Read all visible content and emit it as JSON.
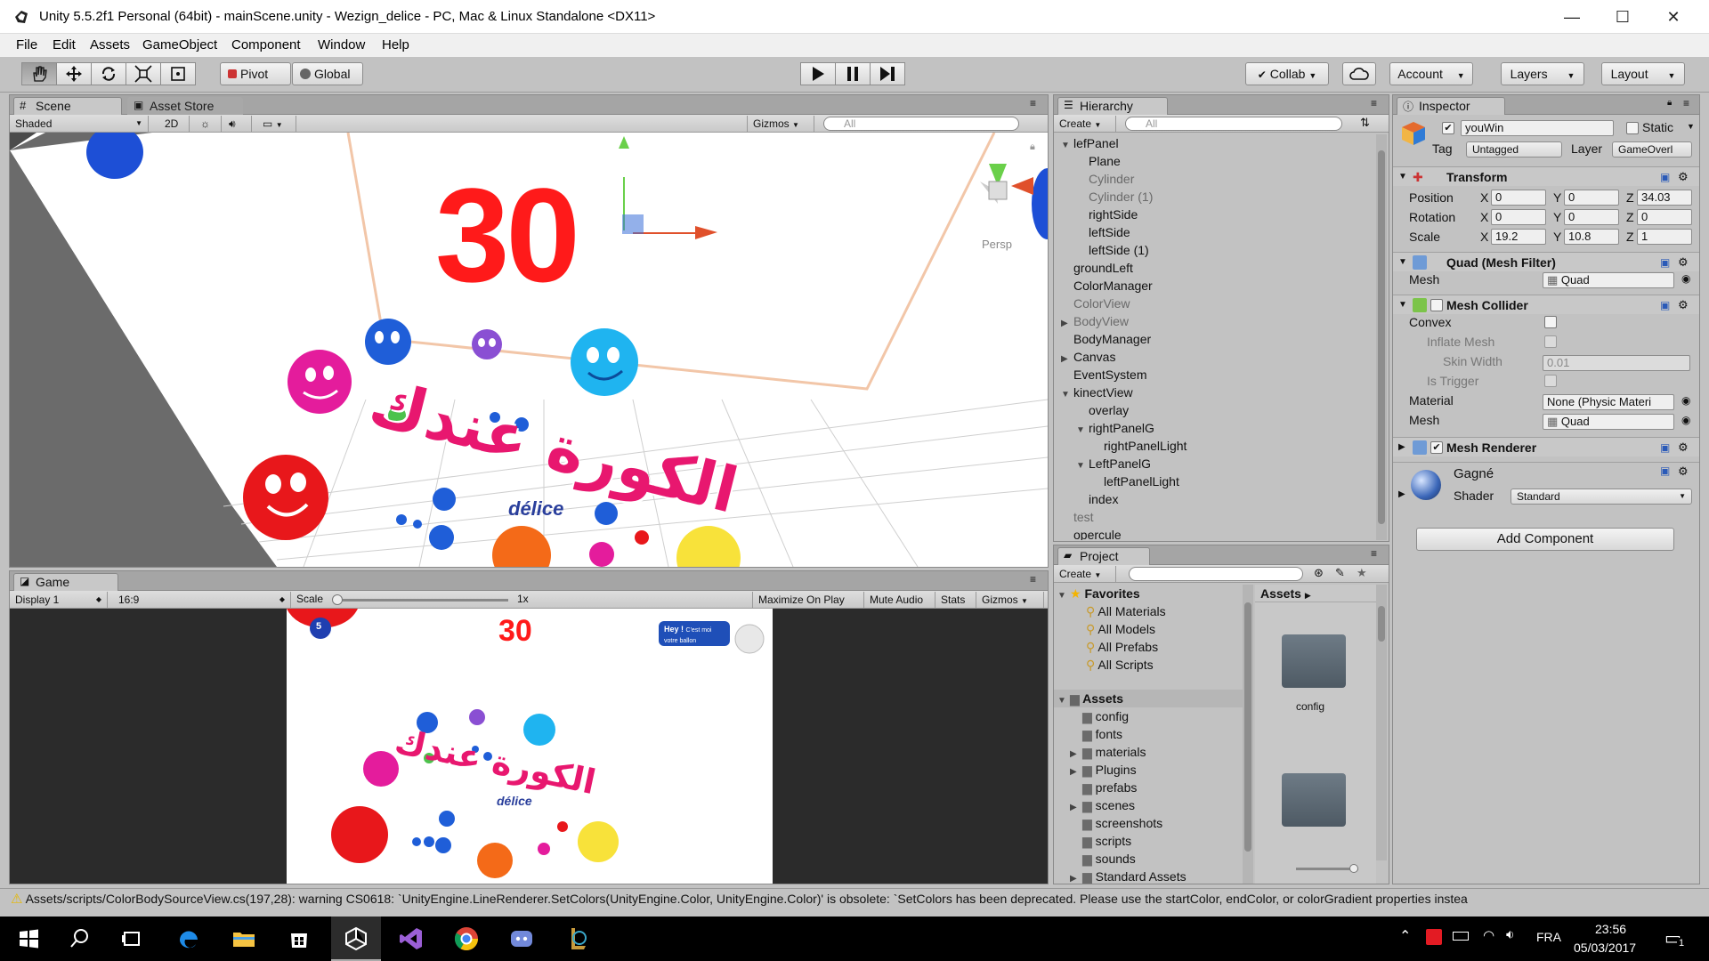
{
  "window": {
    "title": "Unity 5.5.2f1 Personal (64bit) - mainScene.unity - Wezign_delice - PC, Mac & Linux Standalone <DX11>",
    "minimize": "—",
    "maximize": "☐",
    "close": "✕"
  },
  "menu": [
    "File",
    "Edit",
    "Assets",
    "GameObject",
    "Component",
    "Window",
    "Help"
  ],
  "toolbar": {
    "pivot": "Pivot",
    "global": "Global",
    "collab": "Collab",
    "account": "Account",
    "layers": "Layers",
    "layout": "Layout"
  },
  "scene": {
    "tab": "Scene",
    "asset_store_tab": "Asset Store",
    "shading": "Shaded",
    "mode_2d": "2D",
    "gizmos": "Gizmos",
    "search_placeholder": "All",
    "persp": "Persp",
    "counter": "30",
    "arabic_text": "الكورة عندك",
    "brand": "délice"
  },
  "game": {
    "tab": "Game",
    "display": "Display 1",
    "aspect": "16:9",
    "scale_label": "Scale",
    "scale_value": "1x",
    "maximize": "Maximize On Play",
    "mute": "Mute Audio",
    "stats": "Stats",
    "gizmos": "Gizmos",
    "counter": "30",
    "ball_number": "5",
    "bubble_title": "Hey !",
    "bubble_text": "C'est moi votre ballon",
    "arabic_text": "الكورة عندك",
    "brand": "délice"
  },
  "hierarchy": {
    "tab": "Hierarchy",
    "create": "Create",
    "search_placeholder": "All",
    "items": [
      {
        "label": "lefPanel",
        "indent": 0,
        "arrow": "▼",
        "dim": false
      },
      {
        "label": "Plane",
        "indent": 1,
        "arrow": "",
        "dim": false
      },
      {
        "label": "Cylinder",
        "indent": 1,
        "arrow": "",
        "dim": true
      },
      {
        "label": "Cylinder (1)",
        "indent": 1,
        "arrow": "",
        "dim": true
      },
      {
        "label": "rightSide",
        "indent": 1,
        "arrow": "",
        "dim": false
      },
      {
        "label": "leftSide",
        "indent": 1,
        "arrow": "",
        "dim": false
      },
      {
        "label": "leftSide (1)",
        "indent": 1,
        "arrow": "",
        "dim": false
      },
      {
        "label": "groundLeft",
        "indent": 0,
        "arrow": "",
        "dim": false
      },
      {
        "label": "ColorManager",
        "indent": 0,
        "arrow": "",
        "dim": false
      },
      {
        "label": "ColorView",
        "indent": 0,
        "arrow": "",
        "dim": true
      },
      {
        "label": "BodyView",
        "indent": 0,
        "arrow": "▶",
        "dim": true
      },
      {
        "label": "BodyManager",
        "indent": 0,
        "arrow": "",
        "dim": false
      },
      {
        "label": "Canvas",
        "indent": 0,
        "arrow": "▶",
        "dim": false
      },
      {
        "label": "EventSystem",
        "indent": 0,
        "arrow": "",
        "dim": false
      },
      {
        "label": "kinectView",
        "indent": 0,
        "arrow": "▼",
        "dim": false
      },
      {
        "label": "overlay",
        "indent": 1,
        "arrow": "",
        "dim": false
      },
      {
        "label": "rightPanelG",
        "indent": 1,
        "arrow": "▼",
        "dim": false
      },
      {
        "label": "rightPanelLight",
        "indent": 2,
        "arrow": "",
        "dim": false
      },
      {
        "label": "LeftPanelG",
        "indent": 1,
        "arrow": "▼",
        "dim": false
      },
      {
        "label": "leftPanelLight",
        "indent": 2,
        "arrow": "",
        "dim": false
      },
      {
        "label": "index",
        "indent": 1,
        "arrow": "",
        "dim": false
      },
      {
        "label": "test",
        "indent": 0,
        "arrow": "",
        "dim": true
      },
      {
        "label": "opercule",
        "indent": 0,
        "arrow": "",
        "dim": false
      }
    ]
  },
  "project": {
    "tab": "Project",
    "create": "Create",
    "favorites_label": "Favorites",
    "favorites": [
      "All Materials",
      "All Models",
      "All Prefabs",
      "All Scripts"
    ],
    "assets_label": "Assets",
    "folders": [
      {
        "label": "config",
        "arrow": ""
      },
      {
        "label": "fonts",
        "arrow": ""
      },
      {
        "label": "materials",
        "arrow": "▶"
      },
      {
        "label": "Plugins",
        "arrow": "▶"
      },
      {
        "label": "prefabs",
        "arrow": ""
      },
      {
        "label": "scenes",
        "arrow": "▶"
      },
      {
        "label": "screenshots",
        "arrow": ""
      },
      {
        "label": "scripts",
        "arrow": ""
      },
      {
        "label": "sounds",
        "arrow": ""
      },
      {
        "label": "Standard Assets",
        "arrow": "▶"
      }
    ],
    "breadcrumb": "Assets",
    "grid_items": [
      "config"
    ]
  },
  "inspector": {
    "tab": "Inspector",
    "object_name": "youWin",
    "static_label": "Static",
    "tag_label": "Tag",
    "tag_value": "Untagged",
    "layer_label": "Layer",
    "layer_value": "GameOverl",
    "transform": {
      "title": "Transform",
      "position_label": "Position",
      "rotation_label": "Rotation",
      "scale_label": "Scale",
      "position": [
        "0",
        "0",
        "34.03"
      ],
      "rotation": [
        "0",
        "0",
        "0"
      ],
      "scale": [
        "19.2",
        "10.8",
        "1"
      ]
    },
    "mesh_filter": {
      "title": "Quad (Mesh Filter)",
      "mesh_label": "Mesh",
      "mesh_value": "Quad"
    },
    "mesh_collider": {
      "title": "Mesh Collider",
      "convex": "Convex",
      "inflate": "Inflate Mesh",
      "skin_width_label": "Skin Width",
      "skin_width_value": "0.01",
      "is_trigger": "Is Trigger",
      "material_label": "Material",
      "material_value": "None (Physic Materi",
      "mesh_label": "Mesh",
      "mesh_value": "Quad"
    },
    "mesh_renderer": {
      "title": "Mesh Renderer"
    },
    "material": {
      "name": "Gagné",
      "shader_label": "Shader",
      "shader_value": "Standard"
    },
    "add_component": "Add Component"
  },
  "status": {
    "message": "Assets/scripts/ColorBodySourceView.cs(197,28): warning CS0618: `UnityEngine.LineRenderer.SetColors(UnityEngine.Color, UnityEngine.Color)' is obsolete: `SetColors has been deprecated. Please use the startColor, endColor, or colorGradient properties instea"
  },
  "taskbar": {
    "language": "FRA",
    "time": "23:56",
    "date": "05/03/2017",
    "notifications": "1"
  },
  "colors": {
    "unity_gray": "#c2c2c2",
    "counter_red": "#ff1a1a",
    "taskbar": "#000000"
  }
}
